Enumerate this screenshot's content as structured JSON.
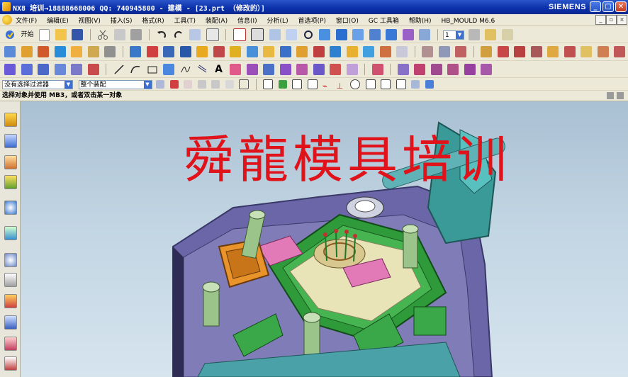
{
  "window": {
    "title": "NX8 培训→18888668006 QQ: 740945800 - 建模 - [23.prt （修改的）]",
    "brand": "SIEMENS",
    "controls": [
      "_",
      "▢",
      "✕"
    ]
  },
  "menubar": {
    "items": [
      "文件(F)",
      "编辑(E)",
      "视图(V)",
      "插入(S)",
      "格式(R)",
      "工具(T)",
      "装配(A)",
      "信息(I)",
      "分析(L)",
      "首选项(P)",
      "窗口(O)",
      "GC 工具箱",
      "帮助(H)",
      "HB_MOULD M6.6"
    ]
  },
  "toolbar": {
    "start_label": "开始",
    "layer_value": "1"
  },
  "selection_bar": {
    "filter_value": "没有选择过滤器",
    "assembly_value": "整个装配"
  },
  "cue_line": "选择对象并使用 MB3，或者双击某一对象",
  "viewport": {
    "watermark": "舜龍模具培训",
    "background_top": "#a9c0d3",
    "background_bottom": "#d6e4ee"
  },
  "icons": {
    "title": "nx-app-icon",
    "start": "start-icon"
  }
}
